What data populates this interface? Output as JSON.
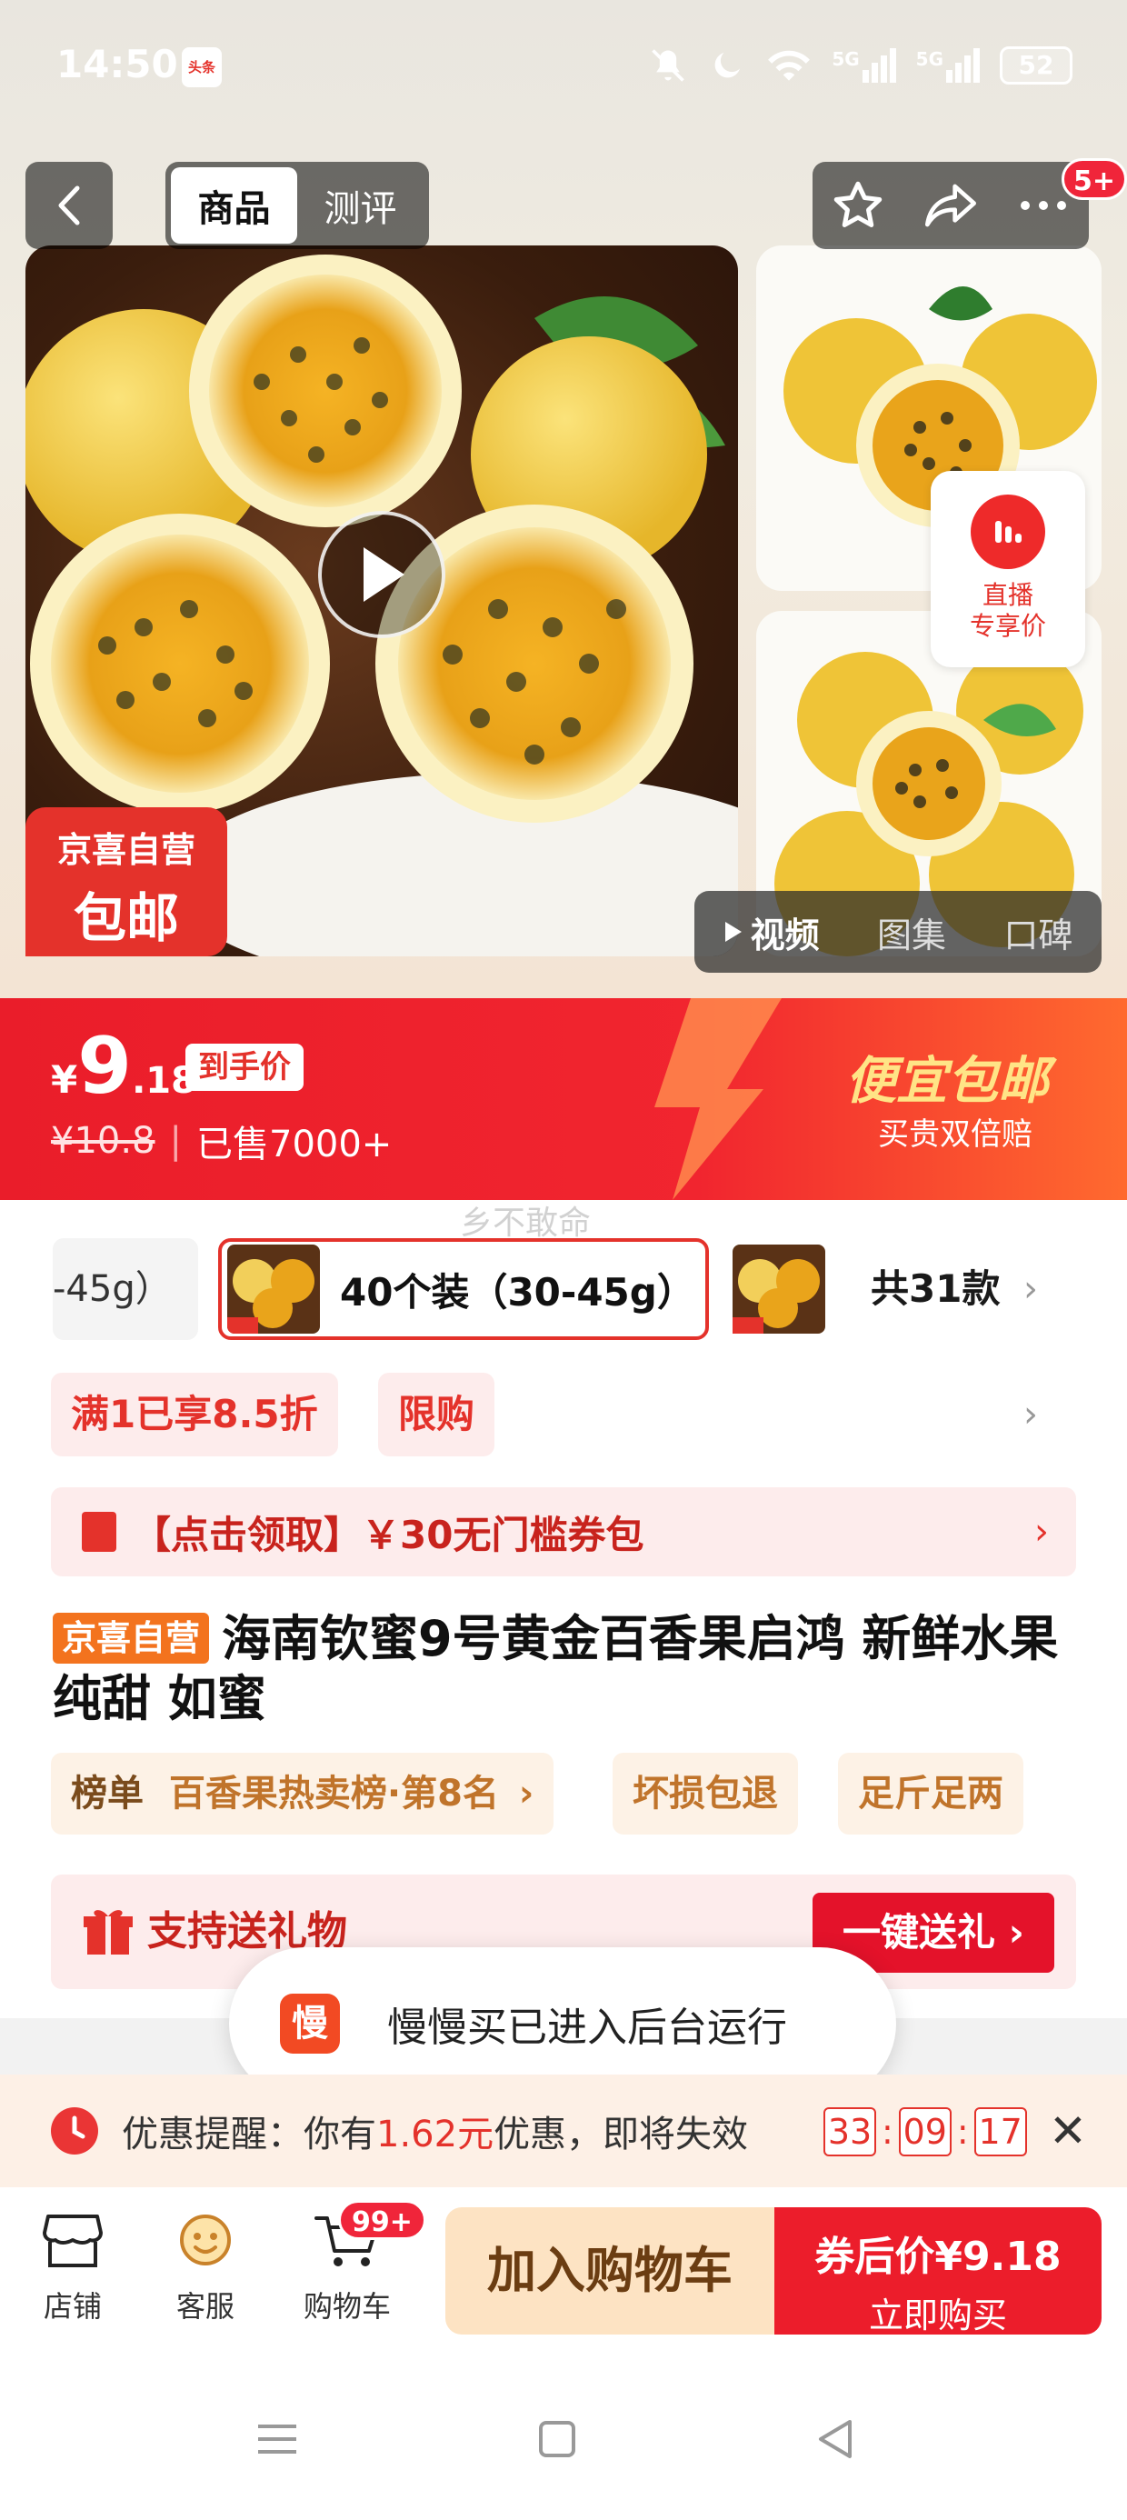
{
  "status_bar": {
    "time": "14:50",
    "app_icon_text": "头条",
    "network_1": "5G",
    "network_2": "5G",
    "battery": "52"
  },
  "header": {
    "tabs": [
      {
        "label": "商品",
        "active": true
      },
      {
        "label": "测评",
        "active": false
      }
    ],
    "message_badge": "5+"
  },
  "gallery": {
    "promo_tag_line1": "京喜自营",
    "promo_tag_line2": "包邮",
    "live_label_line1": "直播",
    "live_label_line2": "专享价",
    "media_tabs": [
      {
        "label": "视频",
        "active": true
      },
      {
        "label": "图集",
        "active": false
      },
      {
        "label": "口碑",
        "active": false
      }
    ]
  },
  "price": {
    "currency": "¥",
    "integer": "9",
    "decimal": ".18",
    "price_tag": "到手价",
    "original": "¥10.8",
    "sold": "已售7000+",
    "slogan": "便宜包邮",
    "slogan_sub": "买贵双倍赔"
  },
  "watermark": "乡不敢命",
  "sku": {
    "prev_label": "-45g）",
    "selected_label": "40个装（30-45g）",
    "total": "共31款"
  },
  "promos": {
    "discount": "满1已享8.5折",
    "limit": "限购"
  },
  "coupon": {
    "text": "【点击领取】￥30无门槛券包"
  },
  "product": {
    "tag": "京喜自营",
    "title": "海南钦蜜9号黄金百香果启鸿 新鲜水果纯甜 如蜜"
  },
  "rank": {
    "label": "榜单",
    "value": "百香果热卖榜·第8名",
    "chevron": "›",
    "chip2": "坏损包退",
    "chip3": "足斤足两"
  },
  "gift": {
    "text": "支持送礼物",
    "button": "一键送礼 ›"
  },
  "toast": {
    "icon_text": "慢",
    "text": "慢慢买已进入后台运行"
  },
  "reminder": {
    "prefix": "优惠提醒：你有",
    "amount": "1.62元",
    "suffix": "优惠，即将失效",
    "timer": [
      "33",
      "09",
      "17"
    ],
    "close": "✕"
  },
  "bottom_bar": {
    "shop": "店铺",
    "service": "客服",
    "cart": "购物车",
    "cart_badge": "99+",
    "add_to_cart": "加入购物车",
    "buy_line1": "券后价¥9.18",
    "buy_line2": "立即购买"
  },
  "colors": {
    "brand_red": "#e4322b",
    "price_gradient_start": "#ea1d2a",
    "price_gradient_end": "#ff6a2f",
    "slogan_yellow": "#ffe486",
    "add_cart_bg": "#fde3c3"
  }
}
